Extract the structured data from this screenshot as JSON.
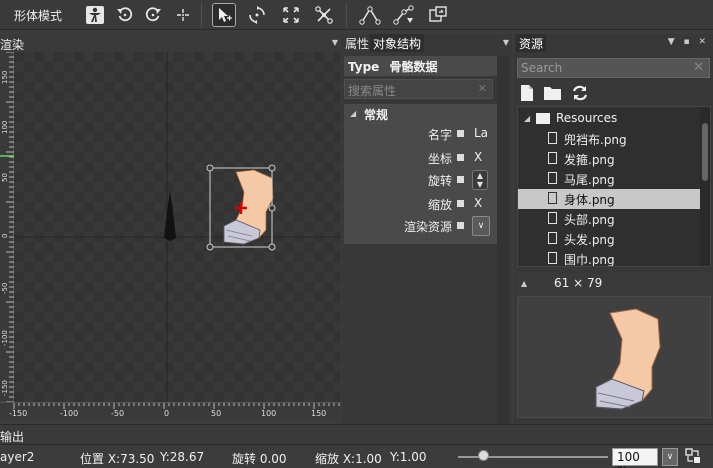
{
  "toolbar": {
    "mode_label": "形体模式",
    "tools": [
      "figure-icon",
      "rotate-ccw-icon",
      "rotate-cw-icon",
      "move-cross-icon",
      "select-arrow-icon",
      "rotate-arrows-icon",
      "scale-icon",
      "bone-link-icon",
      "bone-create-icon",
      "bone-bind-icon",
      "export-frame-icon"
    ]
  },
  "render": {
    "title": "渲染",
    "ruler_bottom_labels": [
      "-150",
      "-100",
      "-50",
      "0",
      "50",
      "100",
      "150"
    ],
    "ruler_left_labels": [
      "150",
      "100",
      "50",
      "0",
      "-50",
      "-100",
      "-150"
    ]
  },
  "props": {
    "tabs": [
      "属性",
      "对象结构"
    ],
    "type_key": "Type",
    "type_value": "骨骼数据",
    "search_placeholder": "搜索属性",
    "group_label": "常规",
    "rows": [
      {
        "name": "名字",
        "value": "La"
      },
      {
        "name": "坐标",
        "value": "X"
      },
      {
        "name": "旋转",
        "value": ""
      },
      {
        "name": "缩放",
        "value": "X"
      },
      {
        "name": "渲染资源",
        "value": ""
      }
    ]
  },
  "resources": {
    "tab": "资源",
    "search_placeholder": "Search",
    "root": "Resources",
    "files": [
      "兜裆布.png",
      "发箍.png",
      "马尾.png",
      "身体.png",
      "头部.png",
      "头发.png",
      "围巾.png"
    ],
    "selected_index": 3,
    "size": "61  ×  79"
  },
  "output": {
    "label": "输出"
  },
  "status": {
    "layer": "ayer2",
    "pos_x": "位置  X:73.50",
    "pos_y": "Y:28.67",
    "rotation": "旋转  0.00",
    "scale_x": "缩放  X:1.00",
    "scale_y": "Y:1.00",
    "zoom": "100 %",
    "zoom_level": 0.17
  }
}
